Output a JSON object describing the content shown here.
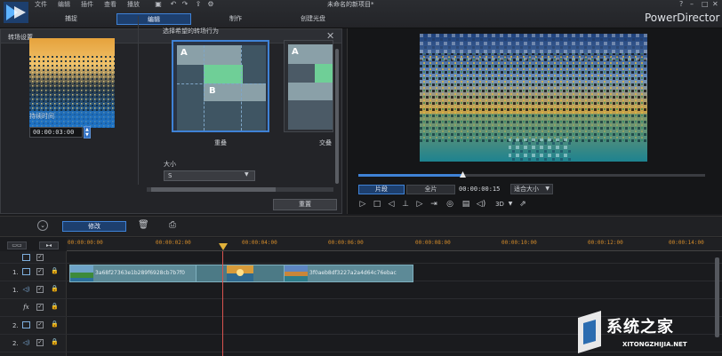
{
  "app": {
    "brand": "PowerDirector",
    "window_title": "未命名的新项目*",
    "menu": [
      "文件",
      "编辑",
      "插件",
      "查看",
      "播放"
    ],
    "main_tabs": [
      "捕捉",
      "编辑",
      "制作",
      "创建光盘"
    ],
    "active_tab": "编辑"
  },
  "transition_panel": {
    "title": "转场设置",
    "duration_label": "持续时间",
    "duration_value": "00:00:03:00",
    "behavior_label": "选择希望的转场行为",
    "options": [
      {
        "label": "重叠",
        "selected": true
      },
      {
        "label": "交叠",
        "selected": false
      }
    ],
    "block_a": "A",
    "block_b": "B",
    "size_label": "大小",
    "size_value": "S",
    "reset_label": "重置"
  },
  "player": {
    "mode_clip": "片段",
    "mode_movie": "全片",
    "timecode": "00:00:00:15",
    "fit_label": "适合大小",
    "three_d": "3D",
    "progress": 0.3
  },
  "timeline": {
    "modify_label": "修改",
    "ruler": [
      "00:00:00:00",
      "00:00:02:00",
      "00:00:04:00",
      "00:00:06:00",
      "00:00:08:00",
      "00:00:10:00",
      "00:00:12:00",
      "00:00:14:00"
    ],
    "tracks": [
      {
        "num": "",
        "icon": "video"
      },
      {
        "num": "1.",
        "icon": "video"
      },
      {
        "num": "1.",
        "icon": "audio"
      },
      {
        "num": "",
        "icon": "fx",
        "label": "fx"
      },
      {
        "num": "2.",
        "icon": "video"
      },
      {
        "num": "2.",
        "icon": "audio"
      }
    ],
    "clip_a_name": "3a68f27363e1b289f6928cb7b7f0",
    "clip_b_name": "3f0aeb8df3227a2a4d64c76ebac"
  },
  "watermark": {
    "brand": "系统之家",
    "url": "XITONGZHIJIA.NET"
  },
  "colors": {
    "accent": "#3f82d6",
    "clip": "#5d8a97",
    "ruler_text": "#d58c2a",
    "playhead": "#d9534f"
  }
}
